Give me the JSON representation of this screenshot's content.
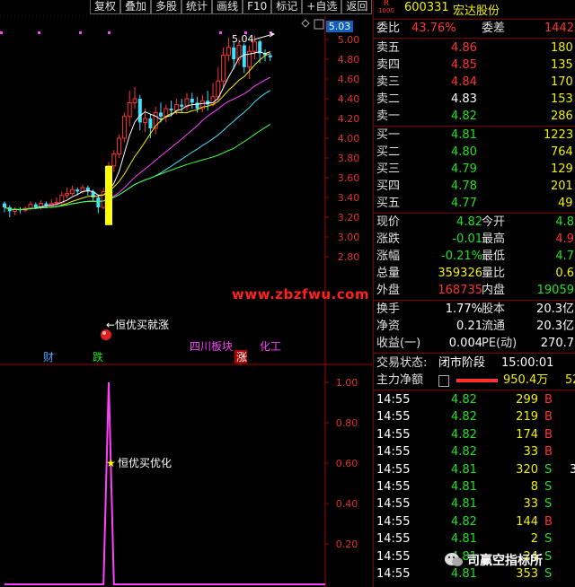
{
  "toolbar": {
    "buttons": [
      "复权",
      "叠加",
      "多股",
      "统计",
      "画线",
      "F10",
      "标记",
      "+自选",
      "返回"
    ]
  },
  "chart": {
    "price_axis": [
      "5.00",
      "4.80",
      "4.60",
      "4.40",
      "4.20",
      "4.00",
      "3.80",
      "3.60",
      "3.40",
      "3.20",
      "3.00",
      "2.80"
    ],
    "current_price_tag": "5.03",
    "high_marker": "5.04",
    "site_watermark": "www.zbzfwu.com",
    "annotation_buy": "←恒优买就涨",
    "tags": [
      {
        "text": "财",
        "color": "#4aa0ff"
      },
      {
        "text": "跌",
        "color": "#20e020"
      },
      {
        "text": "四川板块",
        "color": "#ff40ff"
      },
      {
        "text": "涨",
        "color": "#ffffff"
      },
      {
        "text": "化工",
        "color": "#ff40ff"
      }
    ],
    "indicator_axis": [
      "1.00",
      "0.80",
      "0.60",
      "0.40",
      "0.20"
    ],
    "indicator_label": "恒优买优化",
    "indicator_star": "★"
  },
  "chart_data": {
    "type": "candlestick",
    "ylim": [
      2.7,
      5.1
    ],
    "candles": [
      [
        3.34,
        3.3,
        3.36,
        3.25
      ],
      [
        3.3,
        3.26,
        3.32,
        3.2
      ],
      [
        3.26,
        3.28,
        3.3,
        3.22
      ],
      [
        3.28,
        3.27,
        3.3,
        3.24
      ],
      [
        3.27,
        3.29,
        3.31,
        3.25
      ],
      [
        3.29,
        3.33,
        3.36,
        3.27
      ],
      [
        3.33,
        3.3,
        3.35,
        3.28
      ],
      [
        3.3,
        3.34,
        3.37,
        3.28
      ],
      [
        3.34,
        3.31,
        3.36,
        3.29
      ],
      [
        3.31,
        3.34,
        3.38,
        3.3
      ],
      [
        3.34,
        3.35,
        3.4,
        3.32
      ],
      [
        3.35,
        3.42,
        3.46,
        3.33
      ],
      [
        3.42,
        3.44,
        3.5,
        3.39
      ],
      [
        3.44,
        3.48,
        3.52,
        3.42
      ],
      [
        3.48,
        3.46,
        3.5,
        3.42
      ],
      [
        3.46,
        3.5,
        3.53,
        3.44
      ],
      [
        3.5,
        3.46,
        3.52,
        3.42
      ],
      [
        3.46,
        3.4,
        3.48,
        3.36
      ],
      [
        3.4,
        3.3,
        3.42,
        3.24
      ],
      [
        3.3,
        3.46,
        3.5,
        3.28
      ],
      [
        3.46,
        3.72,
        3.76,
        3.42
      ],
      [
        3.72,
        3.84,
        3.88,
        3.66
      ],
      [
        3.84,
        4.0,
        4.04,
        3.8
      ],
      [
        4.0,
        4.22,
        4.26,
        3.96
      ],
      [
        4.22,
        4.36,
        4.48,
        4.12
      ],
      [
        4.36,
        4.4,
        4.52,
        4.3
      ],
      [
        4.4,
        4.16,
        4.44,
        4.08
      ],
      [
        4.16,
        4.2,
        4.3,
        4.06
      ],
      [
        4.2,
        4.1,
        4.24,
        4.0
      ],
      [
        4.1,
        4.26,
        4.32,
        4.04
      ],
      [
        4.26,
        4.22,
        4.36,
        4.16
      ],
      [
        4.22,
        4.3,
        4.34,
        4.16
      ],
      [
        4.3,
        4.28,
        4.38,
        4.22
      ],
      [
        4.28,
        4.34,
        4.4,
        4.24
      ],
      [
        4.34,
        4.32,
        4.4,
        4.26
      ],
      [
        4.32,
        4.4,
        4.46,
        4.28
      ],
      [
        4.4,
        4.36,
        4.46,
        4.3
      ],
      [
        4.36,
        4.3,
        4.42,
        4.26
      ],
      [
        4.3,
        4.38,
        4.44,
        4.26
      ],
      [
        4.38,
        4.34,
        4.48,
        4.28
      ],
      [
        4.34,
        4.42,
        4.56,
        4.32
      ],
      [
        4.42,
        4.58,
        4.72,
        4.38
      ],
      [
        4.58,
        4.84,
        4.92,
        4.52
      ],
      [
        4.84,
        4.92,
        5.02,
        4.78
      ],
      [
        4.92,
        4.8,
        4.98,
        4.7
      ],
      [
        4.8,
        4.94,
        5.0,
        4.74
      ],
      [
        4.94,
        4.72,
        4.96,
        4.66
      ],
      [
        4.72,
        4.88,
        4.94,
        4.6
      ],
      [
        4.88,
        4.98,
        5.04,
        4.8
      ],
      [
        4.98,
        4.86,
        5.0,
        4.76
      ],
      [
        4.86,
        4.84,
        4.9,
        4.78
      ],
      [
        4.84,
        4.82,
        4.86,
        4.78
      ]
    ],
    "indicator": {
      "ylim": [
        0,
        1.1
      ],
      "values": [
        0,
        0,
        0,
        0,
        0,
        0,
        0,
        0,
        0,
        0,
        0,
        0,
        0,
        0,
        0,
        0,
        0,
        0,
        0,
        0,
        1.0,
        0,
        0,
        0,
        0,
        0,
        0,
        0,
        0,
        0,
        0,
        0,
        0,
        0,
        0,
        0,
        0,
        0,
        0,
        0,
        0,
        0,
        0,
        0,
        0,
        0,
        0,
        0,
        0,
        0,
        0,
        0
      ],
      "signal_index": 20
    },
    "colors": {
      "up": "#ff3232",
      "down": "#40e0ff",
      "ma5": "#ffffff",
      "ma10": "#f0f000",
      "ma20": "#ff40ff",
      "ma30": "#00ff80",
      "ma60": "#40ff40",
      "signal": "#ffff00",
      "indicator": "#ff40ff"
    }
  },
  "quote": {
    "code": "600331",
    "name": "宏达股份",
    "badge": "R\n1000",
    "weibi_label": "委比",
    "weibi": "43.76%",
    "weicha_label": "委差",
    "weicha": "1442",
    "asks": [
      {
        "label": "卖五",
        "price": "4.86",
        "vol": "180"
      },
      {
        "label": "卖四",
        "price": "4.85",
        "vol": "135"
      },
      {
        "label": "卖三",
        "price": "4.84",
        "vol": "170"
      },
      {
        "label": "卖二",
        "price": "4.83",
        "vol": "153"
      },
      {
        "label": "卖一",
        "price": "4.82",
        "vol": "286"
      }
    ],
    "bids": [
      {
        "label": "买一",
        "price": "4.81",
        "vol": "1223"
      },
      {
        "label": "买二",
        "price": "4.80",
        "vol": "764"
      },
      {
        "label": "买三",
        "price": "4.79",
        "vol": "129"
      },
      {
        "label": "买四",
        "price": "4.78",
        "vol": "201"
      },
      {
        "label": "买五",
        "price": "4.77",
        "vol": "49"
      }
    ],
    "stats": [
      {
        "l1": "现价",
        "v1": "4.82",
        "c1": "green",
        "l2": "今开",
        "v2": "4.8",
        "c2": "green"
      },
      {
        "l1": "涨跌",
        "v1": "-0.01",
        "c1": "green",
        "l2": "最高",
        "v2": "4.9",
        "c2": "red"
      },
      {
        "l1": "涨幅",
        "v1": "-0.21%",
        "c1": "green",
        "l2": "最低",
        "v2": "4.7",
        "c2": "green"
      },
      {
        "l1": "总量",
        "v1": "359326",
        "c1": "yellow",
        "l2": "量比",
        "v2": "0.6",
        "c2": "yellow"
      },
      {
        "l1": "外盘",
        "v1": "168735",
        "c1": "red",
        "l2": "内盘",
        "v2": "19059",
        "c2": "green"
      }
    ],
    "stats2": [
      {
        "l1": "换手",
        "v1": "1.77%",
        "l2": "股本",
        "v2": "20.3亿"
      },
      {
        "l1": "净资",
        "v1": "0.21",
        "l2": "流通",
        "v2": "20.3亿"
      },
      {
        "l1": "收益(一)",
        "v1": "0.004",
        "l2": "PE(动)",
        "v2": "270.7"
      }
    ],
    "status_label": "交易状态:",
    "status": "闭市阶段",
    "status_time": "15:00:01",
    "main_flow_label": "主力净额",
    "main_flow": "950.4万",
    "main_flow_extra": "52",
    "trades": [
      {
        "t": "14:55",
        "p": "4.82",
        "v": "299",
        "s": "B",
        "x": ""
      },
      {
        "t": "14:55",
        "p": "4.82",
        "v": "219",
        "s": "B",
        "x": ""
      },
      {
        "t": "14:55",
        "p": "4.82",
        "v": "174",
        "s": "B",
        "x": ""
      },
      {
        "t": "14:55",
        "p": "4.82",
        "v": "33",
        "s": "B",
        "x": ""
      },
      {
        "t": "14:55",
        "p": "4.81",
        "v": "320",
        "s": "S",
        "x": "3"
      },
      {
        "t": "14:55",
        "p": "4.81",
        "v": "8",
        "s": "S",
        "x": ""
      },
      {
        "t": "14:55",
        "p": "4.81",
        "v": "33",
        "s": "S",
        "x": ""
      },
      {
        "t": "14:55",
        "p": "4.82",
        "v": "144",
        "s": "B",
        "x": ""
      },
      {
        "t": "14:55",
        "p": "4.81",
        "v": "2",
        "s": "S",
        "x": ""
      },
      {
        "t": "14:55",
        "p": "4.81",
        "v": "24",
        "s": "S",
        "x": ""
      },
      {
        "t": "14:55",
        "p": "4.81",
        "v": "353",
        "s": "S",
        "x": ""
      }
    ]
  },
  "brand": "司赢空指标所"
}
